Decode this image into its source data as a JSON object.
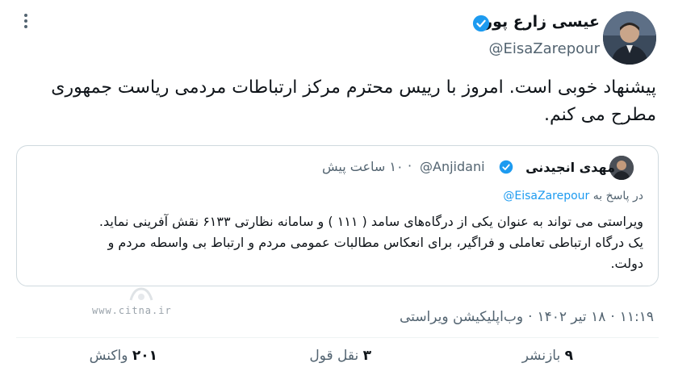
{
  "author": {
    "name": "عیسی زارع پور",
    "handle": "@EisaZarepour"
  },
  "tweet": {
    "text_line1": "پیشنهاد خوبی است. امروز با رییس محترم مرکز ارتباطات مردمی ریاست جمهوری",
    "text_line2": "مطرح می کنم."
  },
  "quoted": {
    "name": "مهدی انجیدنی",
    "handle": "@Anjidani",
    "time": "۱۰ ساعت پیش",
    "reply_prefix": "در پاسخ به",
    "reply_to": "@EisaZarepour",
    "line1": "ویراستی می تواند به عنوان یکی از درگاه‌های سامد ( ۱۱۱ ) و سامانه نظارتی ۶۱۳۳ نقش آفرینی نماید.",
    "line2": "یک درگاه ارتباطی تعاملی و فراگیر، برای انعکاس مطالبات عمومی مردم و ارتباط بی واسطه مردم و",
    "line3": "دولت."
  },
  "watermark": "www.citna.ir",
  "meta": {
    "time": "۱۱:۱۹",
    "date": "۱۸ تیر ۱۴۰۲",
    "source": "وب‌اپلیکیشن ویراستی"
  },
  "stats": {
    "reposts_count": "۹",
    "reposts_label": "بازنشر",
    "quotes_count": "۳",
    "quotes_label": "نقل قول",
    "likes_count": "۲۰۱",
    "likes_label": "واکنش"
  },
  "colors": {
    "verified": "#1d9bf0",
    "text": "#0f1419",
    "secondary": "#536471"
  }
}
